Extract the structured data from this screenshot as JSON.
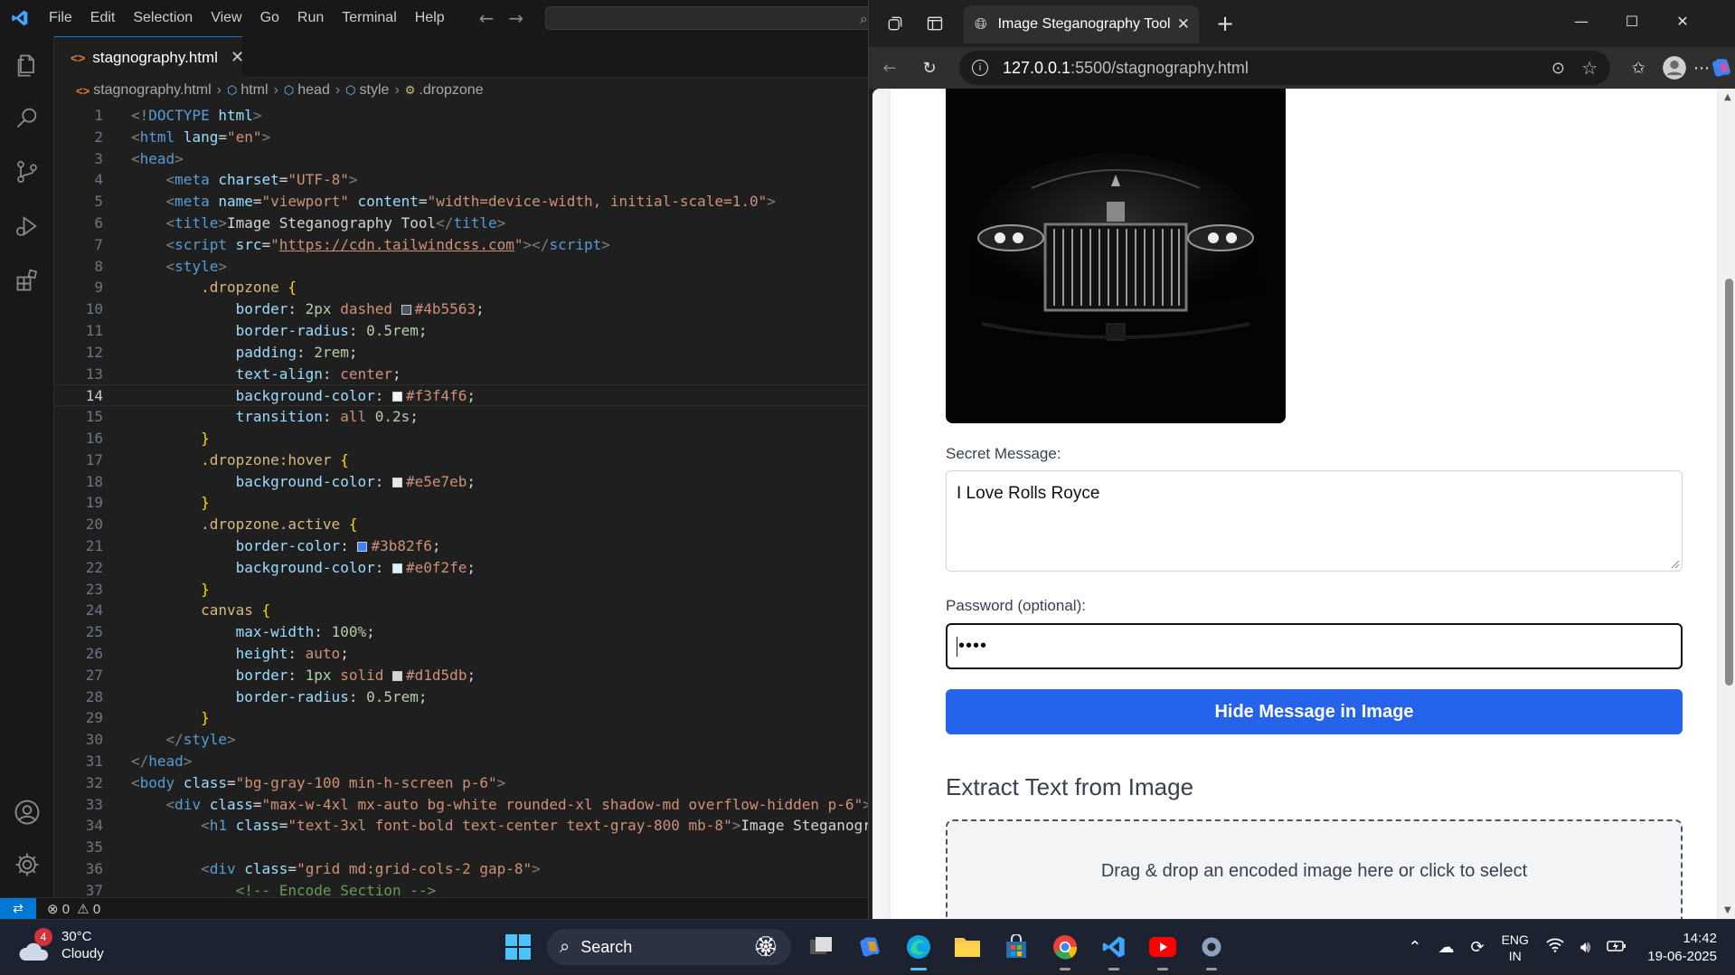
{
  "vscode": {
    "menu": [
      "File",
      "Edit",
      "Selection",
      "View",
      "Go",
      "Run",
      "Terminal",
      "Help"
    ],
    "tab": {
      "label": "stagnography.html"
    },
    "breadcrumb": [
      "stagnography.html",
      "html",
      "head",
      "style",
      ".dropzone"
    ],
    "status": {
      "errors": "0",
      "warnings": "0"
    },
    "active_line": 14,
    "lines": [
      {
        "n": "1"
      },
      {
        "n": "2"
      },
      {
        "n": "3"
      },
      {
        "n": "4"
      },
      {
        "n": "5"
      },
      {
        "n": "6"
      },
      {
        "n": "7"
      },
      {
        "n": "8"
      },
      {
        "n": "9"
      },
      {
        "n": "10"
      },
      {
        "n": "11"
      },
      {
        "n": "12"
      },
      {
        "n": "13"
      },
      {
        "n": "14"
      },
      {
        "n": "15"
      },
      {
        "n": "16"
      },
      {
        "n": "17"
      },
      {
        "n": "18"
      },
      {
        "n": "19"
      },
      {
        "n": "20"
      },
      {
        "n": "21"
      },
      {
        "n": "22"
      },
      {
        "n": "23"
      },
      {
        "n": "24"
      },
      {
        "n": "25"
      },
      {
        "n": "26"
      },
      {
        "n": "27"
      },
      {
        "n": "28"
      },
      {
        "n": "29"
      },
      {
        "n": "30"
      },
      {
        "n": "31"
      },
      {
        "n": "32"
      },
      {
        "n": "33"
      },
      {
        "n": "34"
      },
      {
        "n": "35"
      },
      {
        "n": "36"
      },
      {
        "n": "37"
      }
    ],
    "swatch_colors": {
      "c4b5563": "#4b5563",
      "cf3f4f6": "#f3f4f6",
      "ce5e7eb": "#e5e7eb",
      "c3b82f6": "#3b82f6",
      "ce0f2fe": "#e0f2fe",
      "cd1d5db": "#d1d5db"
    }
  },
  "browser": {
    "tab_title": "Image Steganography Tool",
    "url_host": "127.0.0.1",
    "url_rest": ":5500/stagnography.html",
    "page": {
      "secret_label": "Secret Message:",
      "secret_value": "I Love Rolls Royce",
      "password_label": "Password (optional):",
      "password_value": "••••",
      "hide_button": "Hide Message in Image",
      "extract_title": "Extract Text from Image",
      "dropzone_text": "Drag & drop an encoded image here or click to select"
    }
  },
  "taskbar": {
    "weather_temp": "30°C",
    "weather_cond": "Cloudy",
    "weather_badge": "4",
    "search_label": "Search",
    "lang_top": "ENG",
    "lang_bottom": "IN",
    "time": "14:42",
    "date": "19-06-2025"
  },
  "colors": {
    "accent": "#0078d4",
    "button_blue": "#2563eb"
  }
}
